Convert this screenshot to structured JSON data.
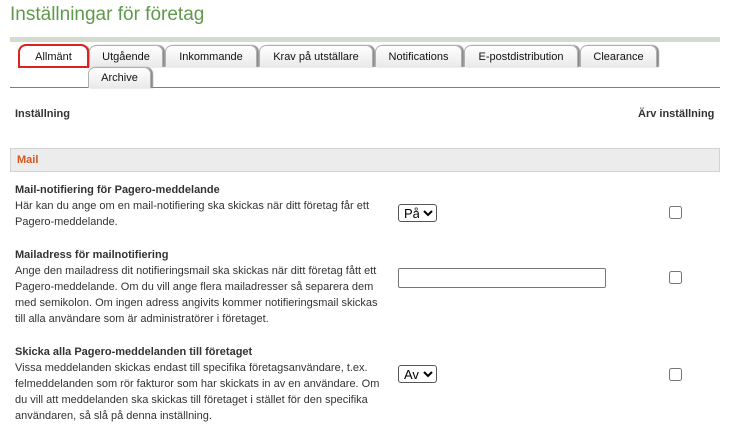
{
  "page": {
    "title": "Inställningar för företag"
  },
  "tabs": [
    {
      "label": "Allmänt",
      "active": true
    },
    {
      "label": "Utgående"
    },
    {
      "label": "Inkommande"
    },
    {
      "label": "Krav på utställare"
    },
    {
      "label": "Notifications"
    },
    {
      "label": "E-postdistribution"
    },
    {
      "label": "Clearance"
    },
    {
      "label": "Archive"
    }
  ],
  "columns": {
    "setting": "Inställning",
    "inherit": "Ärv inställning"
  },
  "section": {
    "title": "Mail"
  },
  "settings": [
    {
      "title": "Mail-notifiering för Pagero-meddelande",
      "description": "Här kan du ange om en mail-notifiering ska skickas när ditt företag får ett Pagero-meddelande.",
      "control": "select",
      "value": "På",
      "inherit_checked": false
    },
    {
      "title": "Mailadress för mailnotifiering",
      "description": "Ange den mailadress dit notifieringsmail ska skickas när ditt företag fått ett Pagero-meddelande. Om du vill ange flera mailadresser så separera dem med semikolon. Om ingen adress angivits kommer notifieringsmail skickas till alla användare som är administratörer i företaget.",
      "control": "text",
      "value": "",
      "inherit_checked": false
    },
    {
      "title": "Skicka alla Pagero-meddelanden till företaget",
      "description": "Vissa meddelanden skickas endast till specifika företagsanvändare, t.ex. felmeddelanden som rör fakturor som har skickats in av en användare. Om du vill att meddelanden ska skickas till företaget i stället för den specifika användaren, så slå på denna inställning.",
      "control": "select",
      "value": "Av",
      "inherit_checked": false
    }
  ]
}
